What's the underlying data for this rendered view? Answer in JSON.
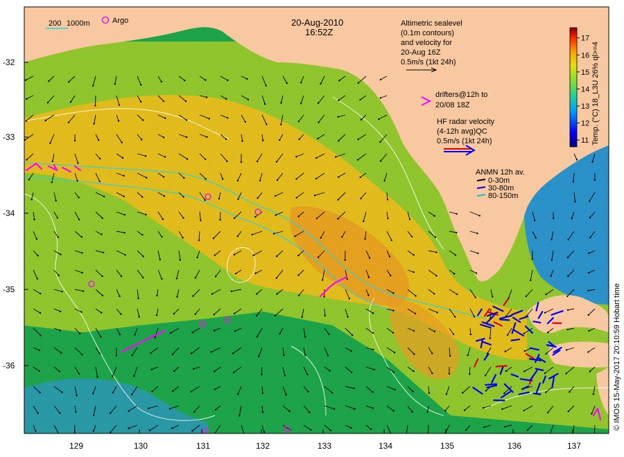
{
  "header": {
    "date": "20-Aug-2010",
    "time": "16:52Z"
  },
  "bathymetry_legend": {
    "depth_a": "200",
    "depth_b": "1000m",
    "argo_label": "Argo"
  },
  "altimetry_note": {
    "lines": [
      "Altimetric sealevel",
      "(0.1m contours)",
      "and velocity for",
      "20-Aug 16Z",
      "0.5m/s (1kt 24h)"
    ]
  },
  "drifters_note": {
    "lines": [
      "drifters@12h to",
      "20/08 18Z"
    ]
  },
  "hf_radar_note": {
    "lines": [
      "HF radar velocity",
      "(4-12h avg)QC",
      "0.5m/s (1kt 24h)"
    ]
  },
  "anmn_legend": {
    "title": "ANMN 12h av.",
    "items": [
      {
        "label": "0-30m",
        "color": "#000000"
      },
      {
        "label": "30-80m",
        "color": "#0000dd"
      },
      {
        "label": "80-150m",
        "color": "#00c8dc"
      }
    ]
  },
  "colorbar": {
    "label": "Temp. (°C) 18_L3U 26% ql>=4",
    "ticks": [
      "11",
      "12",
      "13",
      "14",
      "15",
      "16",
      "17"
    ],
    "min": 10.6,
    "max": 17.6
  },
  "axes": {
    "x_ticks": [
      "129",
      "130",
      "131",
      "132",
      "133",
      "134",
      "135",
      "136",
      "137"
    ],
    "y_ticks": [
      "-32",
      "-33",
      "-34",
      "-35",
      "-36"
    ]
  },
  "credit": "© IMOS 15-May-2017 20:10:59 Hobart time",
  "colors": {
    "land": "#f8c9a0",
    "warm": "#f5c21a",
    "mid": "#9ad230",
    "cool": "#1fae4e",
    "cold": "#1a8fd8",
    "drifter": "#ff00ff",
    "hf_radar_red": "#e00000",
    "hf_radar_blue": "#0000ff"
  }
}
